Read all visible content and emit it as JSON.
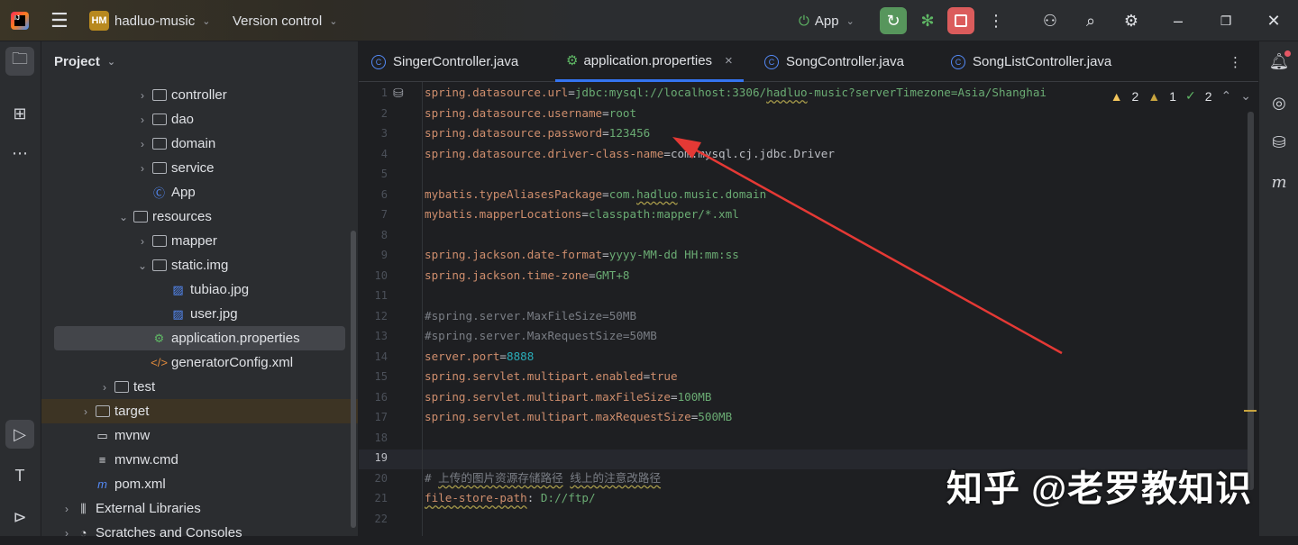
{
  "titlebar": {
    "project_badge": "HM",
    "project_name": "hadluo-music",
    "vcs": "Version control",
    "run_config": "App"
  },
  "panel": {
    "title": "Project"
  },
  "tree": [
    {
      "label": "controller",
      "type": "package",
      "chev": "›"
    },
    {
      "label": "dao",
      "type": "package",
      "chev": "›"
    },
    {
      "label": "domain",
      "type": "package",
      "chev": "›"
    },
    {
      "label": "service",
      "type": "package",
      "chev": "›"
    },
    {
      "label": "App",
      "type": "class",
      "chev": ""
    },
    {
      "label": "resources",
      "type": "folder",
      "chev": "⌄"
    },
    {
      "label": "mapper",
      "type": "folder",
      "chev": "›"
    },
    {
      "label": "static.img",
      "type": "folder",
      "chev": "⌄"
    },
    {
      "label": "tubiao.jpg",
      "type": "image",
      "chev": ""
    },
    {
      "label": "user.jpg",
      "type": "image",
      "chev": ""
    },
    {
      "label": "application.properties",
      "type": "properties",
      "chev": ""
    },
    {
      "label": "generatorConfig.xml",
      "type": "xml",
      "chev": ""
    },
    {
      "label": "test",
      "type": "folder",
      "chev": "›"
    },
    {
      "label": "target",
      "type": "folder",
      "chev": "›"
    },
    {
      "label": "mvnw",
      "type": "file",
      "chev": ""
    },
    {
      "label": "mvnw.cmd",
      "type": "text",
      "chev": ""
    },
    {
      "label": "pom.xml",
      "type": "maven",
      "chev": ""
    },
    {
      "label": "External Libraries",
      "type": "library",
      "chev": "›"
    },
    {
      "label": "Scratches and Consoles",
      "type": "scratch",
      "chev": "›"
    }
  ],
  "tabs": [
    {
      "label": "SingerController.java",
      "icon": "C"
    },
    {
      "label": "application.properties",
      "icon": "P",
      "close": "×"
    },
    {
      "label": "SongController.java",
      "icon": "C"
    },
    {
      "label": "SongListController.java",
      "icon": "C"
    }
  ],
  "inspections": {
    "warnings": "2",
    "weak_warnings": "1",
    "typos": "2"
  },
  "code": [
    [
      [
        "k",
        "spring.datasource.url"
      ],
      [
        "e",
        "="
      ],
      [
        "v",
        "jdbc:mysql://localhost:3306/"
      ],
      [
        "vw",
        "hadluo"
      ],
      [
        "v",
        "-music?serverTimezone=Asia/Shanghai"
      ]
    ],
    [
      [
        "k",
        "spring.datasource.username"
      ],
      [
        "e",
        "="
      ],
      [
        "v",
        "root"
      ]
    ],
    [
      [
        "k",
        "spring.datasource.password"
      ],
      [
        "e",
        "="
      ],
      [
        "v",
        "123456"
      ]
    ],
    [
      [
        "k",
        "spring.datasource.driver-class-name"
      ],
      [
        "e",
        "="
      ],
      [
        "p",
        "com.mysql.cj.jdbc.Driver"
      ]
    ],
    [],
    [
      [
        "k",
        "mybatis.typeAliasesPackage"
      ],
      [
        "e",
        "="
      ],
      [
        "v",
        "com."
      ],
      [
        "vw",
        "hadluo"
      ],
      [
        "v",
        ".music.domain"
      ]
    ],
    [
      [
        "k",
        "mybatis.mapperLocations"
      ],
      [
        "e",
        "="
      ],
      [
        "v",
        "classpath:mapper/*.xml"
      ]
    ],
    [],
    [
      [
        "k",
        "spring.jackson.date-format"
      ],
      [
        "e",
        "="
      ],
      [
        "v",
        "yyyy-MM-dd HH:mm:ss"
      ]
    ],
    [
      [
        "k",
        "spring.jackson.time-zone"
      ],
      [
        "e",
        "="
      ],
      [
        "v",
        "GMT+8"
      ]
    ],
    [],
    [
      [
        "c",
        "#spring.server.MaxFileSize=50MB"
      ]
    ],
    [
      [
        "c",
        "#spring.server.MaxRequestSize=50MB"
      ]
    ],
    [
      [
        "k",
        "server.port"
      ],
      [
        "e",
        "="
      ],
      [
        "n",
        "8888"
      ]
    ],
    [
      [
        "k",
        "spring.servlet.multipart.enabled"
      ],
      [
        "e",
        "="
      ],
      [
        "k",
        "true"
      ]
    ],
    [
      [
        "k",
        "spring.servlet.multipart.maxFileSize"
      ],
      [
        "e",
        "="
      ],
      [
        "v",
        "100MB"
      ]
    ],
    [
      [
        "k",
        "spring.servlet.multipart.maxRequestSize"
      ],
      [
        "e",
        "="
      ],
      [
        "v",
        "500MB"
      ]
    ],
    [],
    [],
    [
      [
        "c",
        "# "
      ],
      [
        "cw",
        "上传的图片资源存储路径"
      ],
      [
        "c",
        " "
      ],
      [
        "cw",
        "线上的注意改路径"
      ]
    ],
    [
      [
        "kw",
        "file-store-path"
      ],
      [
        "e",
        ": "
      ],
      [
        "v",
        "D://ftp/"
      ]
    ],
    []
  ],
  "watermark": "知乎 @老罗教知识",
  "colors": {
    "accent": "#3574f0",
    "annotation_arrow": "#e53935"
  }
}
